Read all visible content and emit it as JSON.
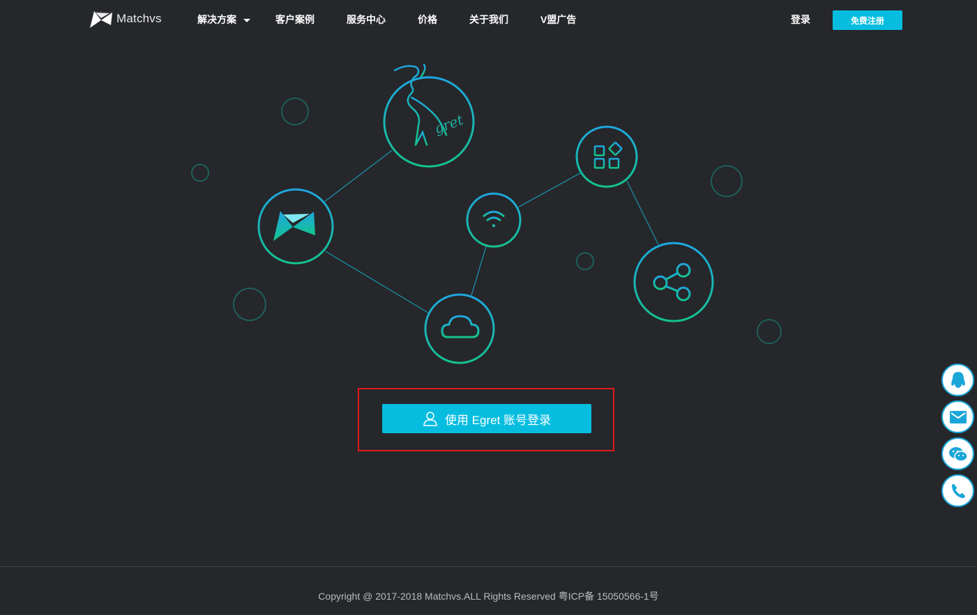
{
  "header": {
    "logo_text": "Matchvs",
    "nav": [
      {
        "label": "解决方案",
        "has_dropdown": true
      },
      {
        "label": "客户案例"
      },
      {
        "label": "服务中心"
      },
      {
        "label": "价格"
      },
      {
        "label": "关于我们"
      },
      {
        "label": "V盟广告"
      }
    ],
    "login_label": "登录",
    "register_label": "免费注册"
  },
  "hero": {
    "egret_logo_text": "gret",
    "nodes": [
      "egret-logo",
      "matchvs-logo",
      "wifi-icon",
      "apps-icon",
      "share-icon",
      "cloud-icon"
    ]
  },
  "main": {
    "egret_login_label": "使用 Egret 账号登录"
  },
  "side_tools": [
    "qq-icon",
    "mail-icon",
    "wechat-icon",
    "phone-icon"
  ],
  "footer": {
    "copyright": "Copyright @ 2017-2018 Matchvs.ALL Rights Reserved 粤ICP备 15050566-1号"
  },
  "colors": {
    "background": "#25272b",
    "accent": "#06bde0",
    "gradient_start": "#1ea7e0",
    "gradient_end": "#14c38e",
    "highlight": "#e01a1a"
  }
}
